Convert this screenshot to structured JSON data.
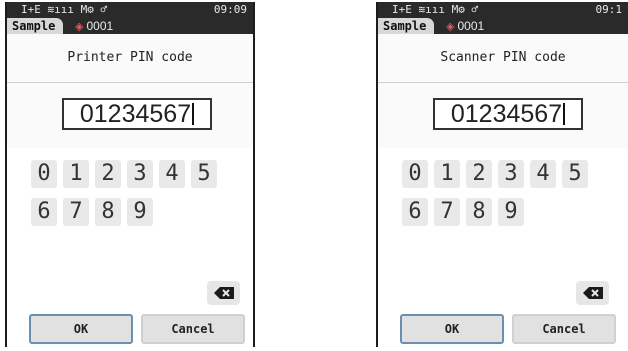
{
  "screens": [
    {
      "status": {
        "icons": "I+E ≋ııı M⚙ ♂",
        "time": "09:09"
      },
      "tab": {
        "label": "Sample",
        "number": "0001"
      },
      "title": "Printer PIN code",
      "pin_value": "01234567",
      "keys": [
        "0",
        "1",
        "2",
        "3",
        "4",
        "5",
        "6",
        "7",
        "8",
        "9"
      ],
      "ok_label": "OK",
      "cancel_label": "Cancel"
    },
    {
      "status": {
        "icons": "I+E ≋ııı M⚙ ♂",
        "time": "09:1"
      },
      "tab": {
        "label": "Sample",
        "number": "0001"
      },
      "title": "Scanner PIN code",
      "pin_value": "01234567",
      "keys": [
        "0",
        "1",
        "2",
        "3",
        "4",
        "5",
        "6",
        "7",
        "8",
        "9"
      ],
      "ok_label": "OK",
      "cancel_label": "Cancel"
    }
  ],
  "colors": {
    "status_bg": "#2a2a2a",
    "tab_bg": "#d8d8d8",
    "key_bg": "#e9e9e9",
    "ok_border": "#6a8fb0",
    "sample_mark": "#e25b62"
  },
  "icons": {
    "sample_mark": "target-icon",
    "backspace": "backspace-icon"
  }
}
